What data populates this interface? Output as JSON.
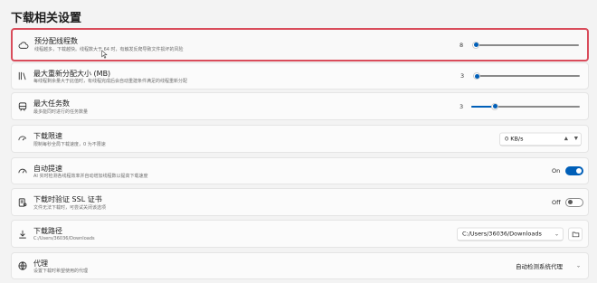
{
  "page": {
    "title": "下载相关设置"
  },
  "rows": {
    "threads": {
      "title": "预分配线程数",
      "desc": "线程越多，下载越快。线程数大于 64 时，有触发反爬导致文件损坏的风险",
      "value": "8",
      "fraction": 0.0
    },
    "max_split": {
      "title": "最大重新分配大小 (MB)",
      "desc": "每线程剩余量大于此值时，有线程完成后会自动重建条件满足的线程重新分配",
      "value": "3",
      "fraction": 0.0
    },
    "max_tasks": {
      "title": "最大任务数",
      "desc": "最多能同时进行的任务数量",
      "value": "3",
      "fraction": 0.2
    },
    "speed_limit": {
      "title": "下载限速",
      "desc": "限制每秒全局下载速度，0 为不限速",
      "value": "0 KB/s",
      "up": "▲",
      "down": "▼"
    },
    "auto_speed": {
      "title": "自动提速",
      "desc": "AI 实时检测各线程效率并自动增加线程数以提高下载速度",
      "state": "On"
    },
    "ssl_verify": {
      "title": "下载时验证 SSL 证书",
      "desc": "文件无法下载时，可尝试关闭该选项",
      "state": "Off"
    },
    "download_path": {
      "title": "下载路径",
      "desc": "C:/Users/36036/Downloads",
      "value": "C:/Users/36036/Downloads",
      "chevron": "⌄"
    },
    "proxy": {
      "title": "代理",
      "desc": "设置下载时希望使用的代理",
      "value": "自动检测系统代理",
      "chevron": "⌄"
    }
  },
  "icons": {
    "threads": "cloud-icon",
    "max_split": "library-icon",
    "max_tasks": "train-icon",
    "speed_limit": "speed-icon",
    "auto_speed": "gauge-icon",
    "ssl_verify": "certificate-icon",
    "download_path": "download-icon",
    "proxy": "globe-icon",
    "folder": "folder-icon"
  },
  "colors": {
    "accent": "#005fb8",
    "highlight_border": "#d94c5b"
  }
}
